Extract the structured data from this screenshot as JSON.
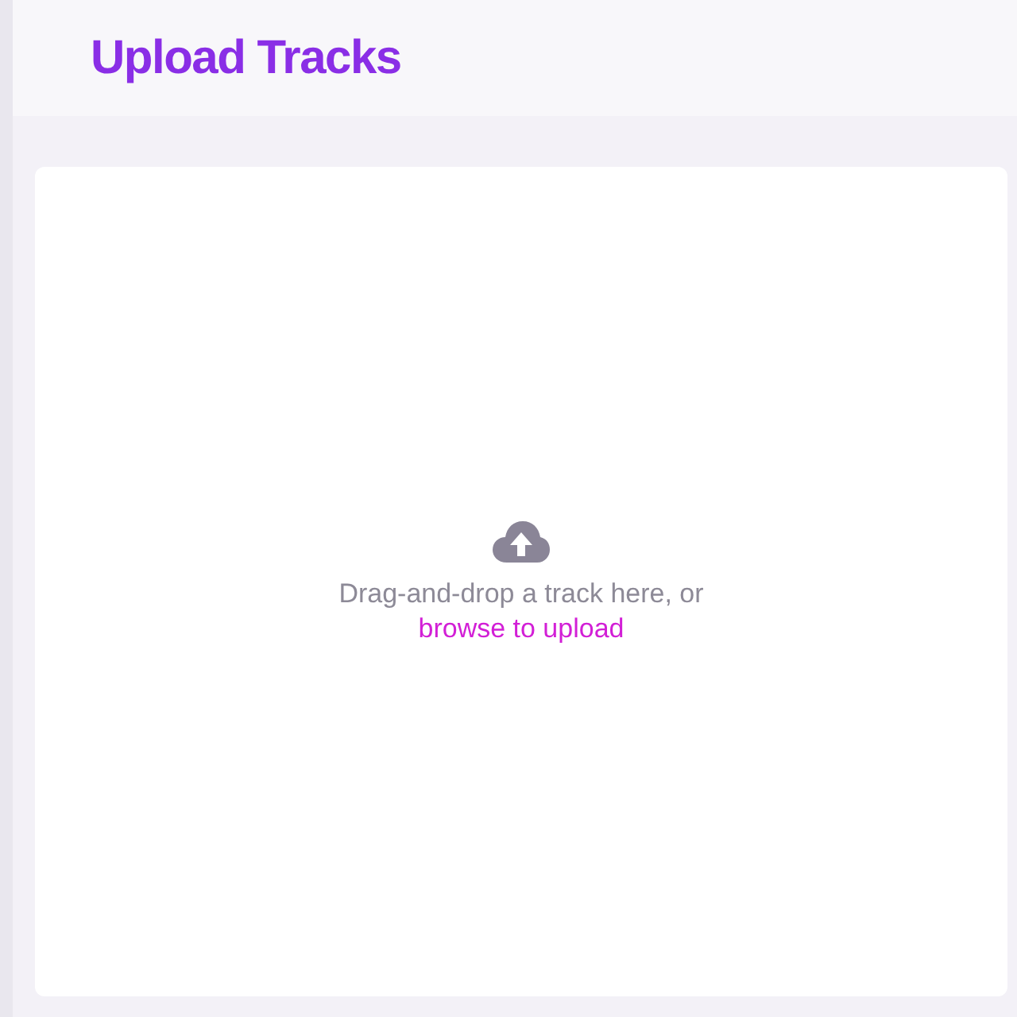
{
  "header": {
    "title": "Upload Tracks"
  },
  "dropzone": {
    "text": "Drag-and-drop a track here, or",
    "link": "browse to upload"
  }
}
